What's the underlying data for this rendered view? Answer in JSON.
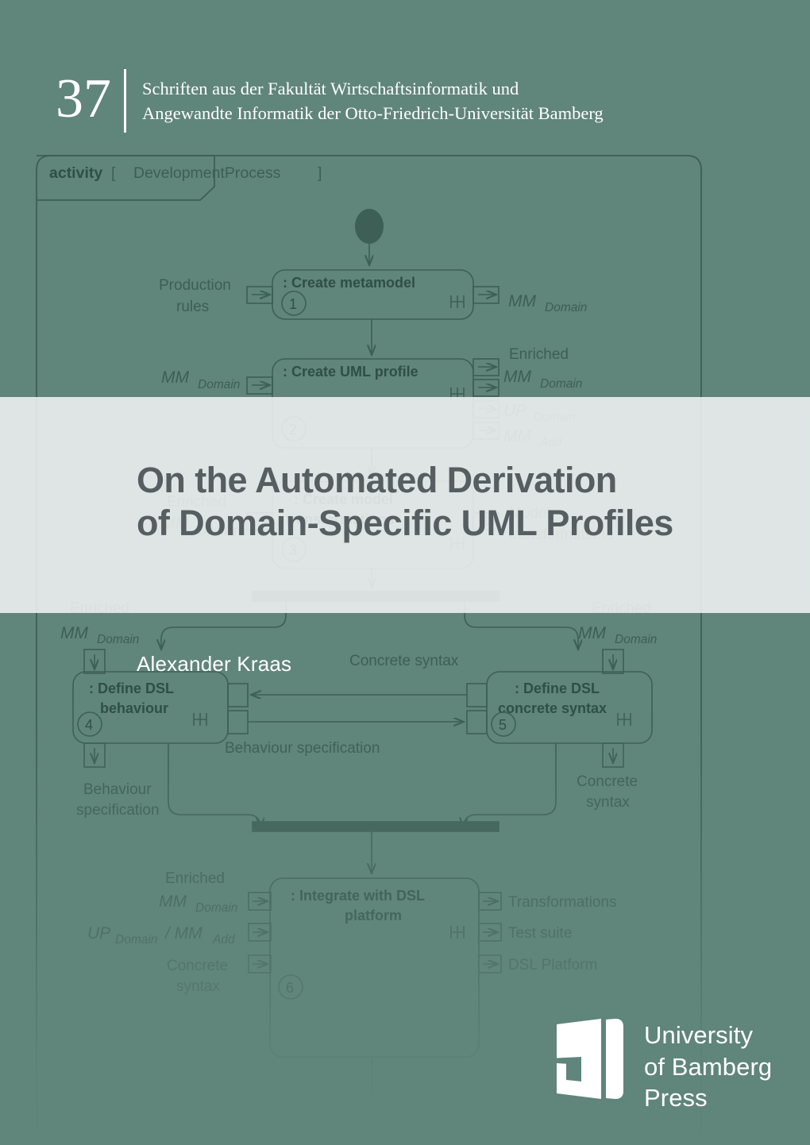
{
  "colors": {
    "background": "#60857a",
    "band": "#e3e7e6",
    "title_text": "#565e62",
    "series_text": "#ffffff",
    "diagram_stroke": "#4d7064"
  },
  "series": {
    "number": "37",
    "line1": "Schriften aus der Fakultät Wirtschaftsinformatik und",
    "line2": "Angewandte Informatik der Otto-Friedrich-Universität Bamberg"
  },
  "title": {
    "line1": "On the Automated Derivation",
    "line2": "of Domain-Specific UML Profiles"
  },
  "author": "Alexander Kraas",
  "publisher": {
    "line1": "University",
    "line2": "of Bamberg",
    "line3": "Press"
  },
  "diagram": {
    "frame_keyword": "activity",
    "frame_bracket_open": "[",
    "frame_name": "DevelopmentProcess",
    "frame_bracket_close": "]",
    "nodes": [
      {
        "number": "1",
        "label_line1": ": Create metamodel",
        "label_line2": "",
        "inputs": [
          "Production",
          "rules"
        ],
        "outputs": [
          "MM",
          "Domain"
        ]
      },
      {
        "number": "2",
        "label_line1": ": Create UML profile",
        "label_line2": "",
        "inputs": [
          "MM",
          "Domain"
        ],
        "outputs": [
          "Enriched",
          "MM",
          "Domain",
          "UP",
          "Domain",
          "MM",
          "Add"
        ]
      },
      {
        "number": "3",
        "label_line1": ": Create model",
        "label_line2": "transformations",
        "inputs": [
          "Enriched",
          "MM",
          "Domain"
        ],
        "outputs": [
          "Model",
          "transformations"
        ]
      },
      {
        "number": "4",
        "label_line1": ": Define DSL",
        "label_line2": "behaviour",
        "inputs": [
          "Enriched",
          "MM",
          "Domain"
        ],
        "outputs": [
          "Behaviour",
          "specification"
        ]
      },
      {
        "number": "5",
        "label_line1": ": Define DSL",
        "label_line2": "concrete syntax",
        "inputs": [
          "Enriched",
          "MM",
          "Domain"
        ],
        "outputs": [
          "Concrete",
          "syntax"
        ]
      },
      {
        "number": "6",
        "label_line1": ": Integrate with DSL",
        "label_line2": "platform",
        "inputs": [
          "Enriched",
          "MM",
          "Domain",
          "UP",
          "Domain",
          "/ MM",
          "Add",
          "Concrete",
          "syntax"
        ],
        "outputs": [
          "Transformations",
          "Test suite",
          "DSL Platform"
        ]
      }
    ],
    "edge_labels": [
      "Concrete syntax",
      "Behaviour specification"
    ],
    "pin_labels": {
      "mm": "MM",
      "up": "UP",
      "domain": "Domain",
      "add": "Add",
      "enriched": "Enriched",
      "production_rules_1": "Production",
      "production_rules_2": "rules",
      "model": "Model",
      "transformations": "transformations",
      "behaviour": "Behaviour",
      "specification": "specification",
      "concrete": "Concrete",
      "syntax": "syntax",
      "transformations_out": "Transformations",
      "test_suite": "Test suite",
      "dsl_platform": "DSL Platform"
    }
  }
}
